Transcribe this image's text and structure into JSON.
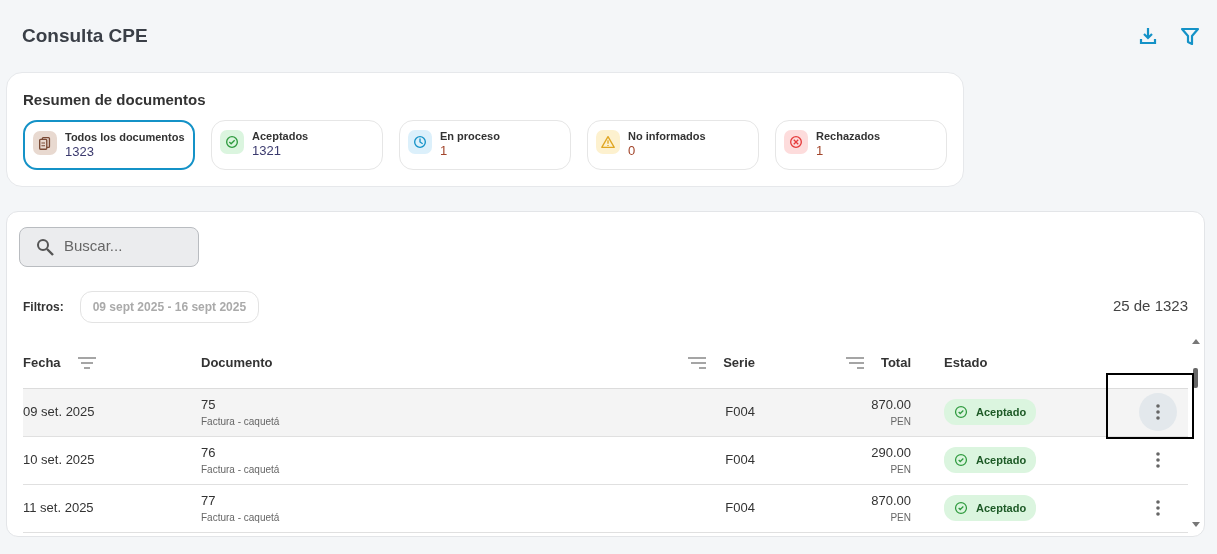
{
  "page": {
    "title": "Consulta CPE"
  },
  "summary": {
    "title": "Resumen de documentos",
    "items": [
      {
        "label": "Todos los documentos",
        "count": "1323",
        "kind": "all",
        "selected": true
      },
      {
        "label": "Aceptados",
        "count": "1321",
        "kind": "accepted",
        "selected": false
      },
      {
        "label": "En proceso",
        "count": "1",
        "kind": "pending",
        "selected": false
      },
      {
        "label": "No informados",
        "count": "0",
        "kind": "warning",
        "selected": false
      },
      {
        "label": "Rechazados",
        "count": "1",
        "kind": "rejected",
        "selected": false
      }
    ]
  },
  "search": {
    "placeholder": "Buscar..."
  },
  "filters": {
    "label": "Filtros:",
    "chips": [
      "09 sept 2025 - 16 sept 2025"
    ],
    "count": "25 de 1323"
  },
  "table": {
    "columns": [
      {
        "label": "Fecha",
        "sortable": true
      },
      {
        "label": "Documento"
      },
      {
        "label": "Serie",
        "sortable": true
      },
      {
        "label": "Total",
        "sortable": true
      },
      {
        "label": "Estado"
      }
    ],
    "rows": [
      {
        "fecha": "09 set. 2025",
        "numero": "75",
        "tipo": "Factura - caquetá",
        "serie": "F004",
        "total": "870.00",
        "moneda": "PEN",
        "estado": {
          "label": "Aceptado",
          "kind": "accepted"
        },
        "highlighted": true
      },
      {
        "fecha": "10 set. 2025",
        "numero": "76",
        "tipo": "Factura - caquetá",
        "serie": "F004",
        "total": "290.00",
        "moneda": "PEN",
        "estado": {
          "label": "Aceptado",
          "kind": "accepted"
        },
        "highlighted": false
      },
      {
        "fecha": "11 set. 2025",
        "numero": "77",
        "tipo": "Factura - caquetá",
        "serie": "F004",
        "total": "870.00",
        "moneda": "PEN",
        "estado": {
          "label": "Aceptado",
          "kind": "accepted"
        },
        "highlighted": false
      }
    ]
  }
}
